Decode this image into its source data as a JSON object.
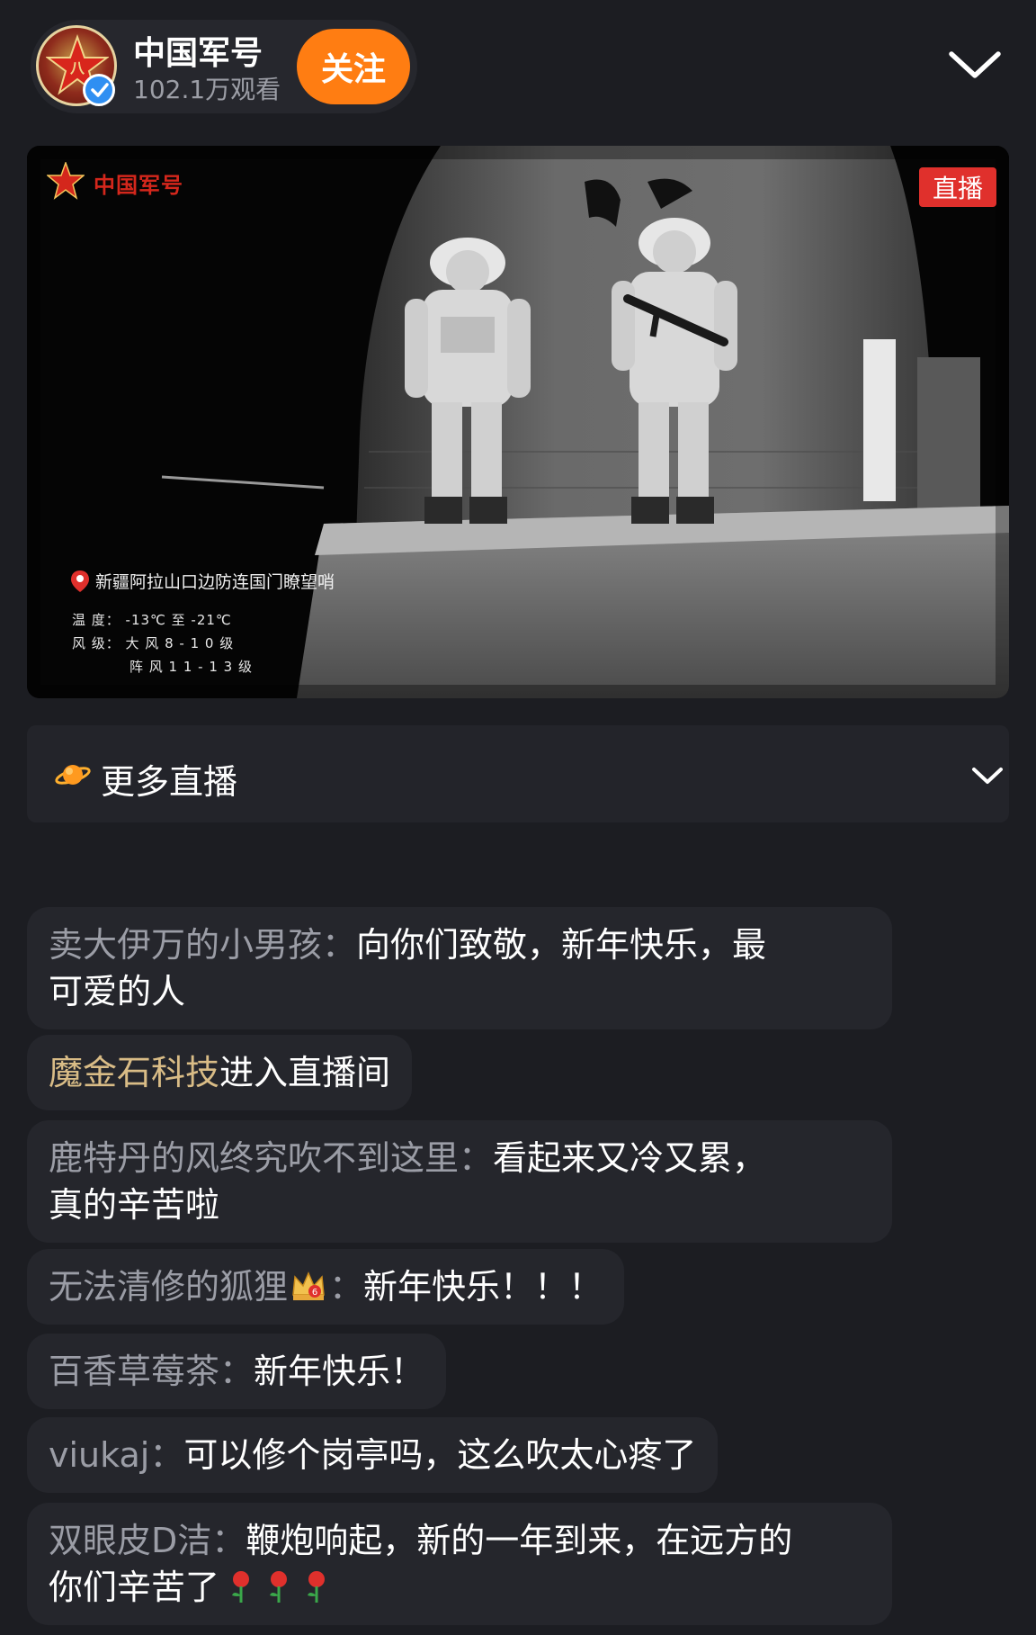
{
  "header": {
    "host_name": "中国军号",
    "viewers": "102.1万观看",
    "follow_label": "关注",
    "icons": {
      "avatar": "army-star-avatar",
      "verified": "verified-check-icon",
      "collapse": "chevron-down-icon"
    },
    "colors": {
      "follow": "#ff7d12",
      "verified": "#2f8ff2"
    }
  },
  "video": {
    "logo_text": "中国军号",
    "live_badge": "直播",
    "location": "新疆阿拉山口边防连国门瞭望哨",
    "temperature": "温 度：  -13℃ 至 -21℃",
    "wind": "风 级：  大 风  8 - 1 0  级",
    "gust": "阵 风  1 1 - 1 3  级",
    "colors": {
      "live_badge": "#e0302c",
      "logo": "#d4271c"
    }
  },
  "more_live": {
    "label": "更多直播",
    "icons": {
      "planet": "planet-icon",
      "expand": "chevron-down-icon"
    }
  },
  "chat": [
    {
      "user": "卖大伊万的小男孩",
      "sep": "：",
      "line1": "向你们致敬，新年快乐，最",
      "line2": "可爱的人"
    },
    {
      "user": "魔金石科技",
      "msg": "进入直播间"
    },
    {
      "user": "鹿特丹的风终究吹不到这里",
      "sep": "：",
      "line1": "看起来又冷又累，",
      "line2": "真的辛苦啦"
    },
    {
      "user": "无法清修的狐狸",
      "sep": "：",
      "msg": "新年快乐！！！"
    },
    {
      "user": "百香草莓茶",
      "sep": "：",
      "msg": "新年快乐！"
    },
    {
      "user": "viukaj",
      "sep": "：",
      "msg": "可以修个岗亭吗，这么吹太心疼了"
    },
    {
      "user": "双眼皮D洁",
      "sep": "：",
      "line1": "鞭炮响起，新的一年到来，在远方的",
      "line2": "你们辛苦了"
    }
  ]
}
